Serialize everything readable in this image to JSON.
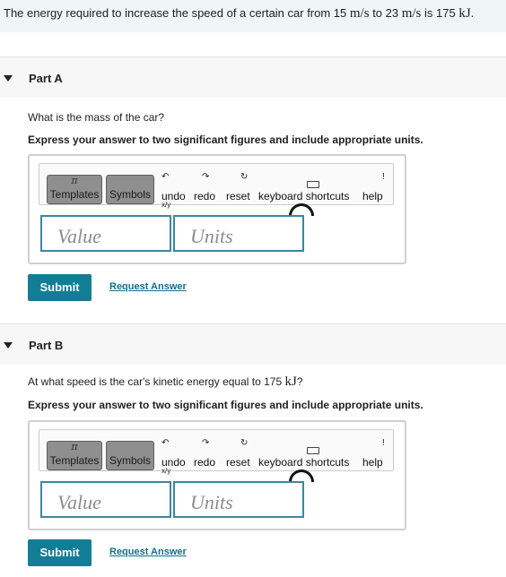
{
  "problem": {
    "text_1": "The energy required to increase the speed of a certain car from 15 ",
    "unit_1": "m/s",
    "text_2": " to 23 ",
    "unit_2": "m/s",
    "text_3": " is 175 ",
    "unit_3": "kJ",
    "text_4": "."
  },
  "parts": [
    {
      "title": "Part A",
      "question_1": "What is the mass of the car?",
      "question_unit": "",
      "question_2": "",
      "instruction": "Express your answer to two significant figures and include appropriate units.",
      "toolbar": {
        "templates_label": "Templates",
        "symbols_label": "Symbols",
        "undo_label": "undo",
        "redo_label": "redo",
        "reset_label": "reset",
        "shortcuts_label": "keyboard shortcuts",
        "help_label": "help"
      },
      "value_placeholder": "Value",
      "units_placeholder": "Units",
      "submit_label": "Submit",
      "request_label": "Request Answer"
    },
    {
      "title": "Part B",
      "question_1": "At what speed is the car's kinetic energy equal to 175 ",
      "question_unit": "kJ",
      "question_2": "?",
      "instruction": "Express your answer to two significant figures and include appropriate units.",
      "toolbar": {
        "templates_label": "Templates",
        "symbols_label": "Symbols",
        "undo_label": "undo",
        "redo_label": "redo",
        "reset_label": "reset",
        "shortcuts_label": "keyboard shortcuts",
        "help_label": "help"
      },
      "value_placeholder": "Value",
      "units_placeholder": "Units",
      "submit_label": "Submit",
      "request_label": "Request Answer"
    }
  ],
  "colors": {
    "banner_bg": "#eef6f7",
    "field_border": "#3c86a0",
    "submit_bg": "#147d96",
    "link": "#14708a"
  },
  "icons": [
    "collapse-triangle-icon",
    "templates-icon",
    "symbols-icon",
    "undo-icon",
    "redo-icon",
    "reset-icon",
    "keyboard-icon",
    "help-icon"
  ]
}
